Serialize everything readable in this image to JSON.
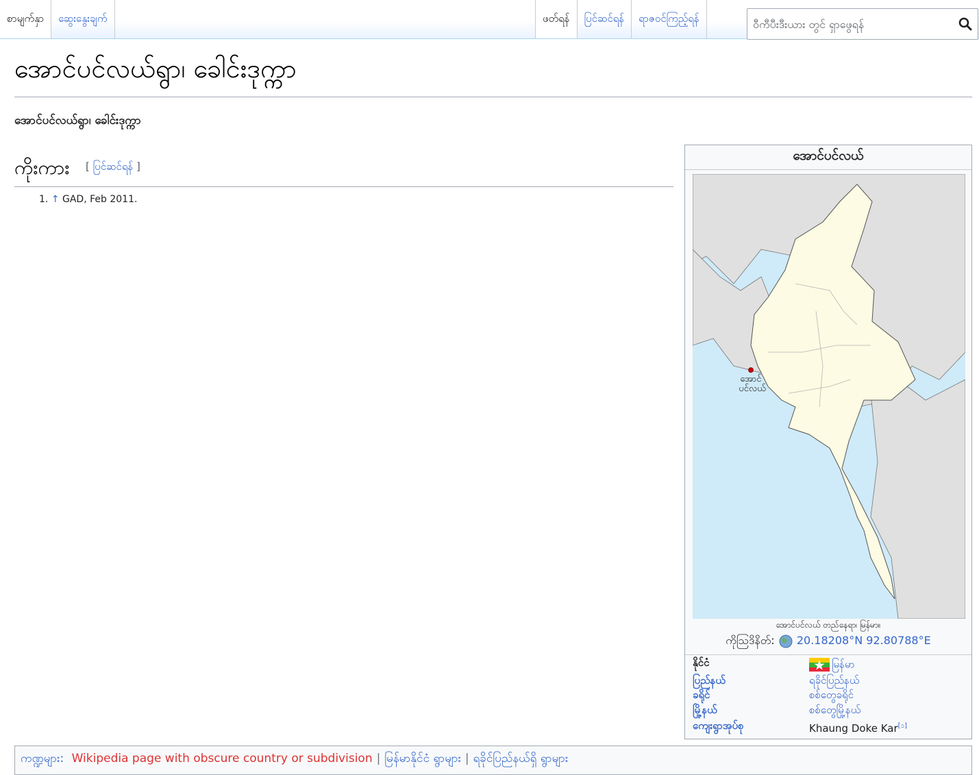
{
  "tabs": {
    "article": "စာမျက်နှာ",
    "talk": "ဆွေးနွေးချက်",
    "read": "ဖတ်ရန်",
    "edit": "ပြင်ဆင်ရန်",
    "history": "ရာဇဝင်ကြည့်ရန်"
  },
  "search": {
    "placeholder": "ဝီကီပီးဒီးယား တွင် ရှာဖွေရန်",
    "icon": "magnifier"
  },
  "page": {
    "title": "အောင်ပင်လယ်ရွာ၊ ခေါင်းဒုက္ကာ",
    "lead": "အောင်ပင်လယ်ရွာ၊ ခေါင်းဒုက္ကာ"
  },
  "section": {
    "heading": "ကိုးကား",
    "edit_open": "[ ",
    "edit_label": "ပြင်ဆင်ရန်",
    "edit_close": " ]"
  },
  "references": [
    {
      "num": "1.",
      "backlink": "↑",
      "text": "GAD, Feb 2011."
    }
  ],
  "infobox": {
    "title": "အောင်ပင်လယ်",
    "map_label_1": "အောင်",
    "map_label_2": "ပင်လယ်",
    "caption": "အောင်ပင်လယ် တည်နေရာ၊ မြန်မာ။",
    "coords_label": "ကိုဩဒိနိတ်:",
    "coords_value": "20.18208°N 92.80788°E",
    "rows": [
      {
        "label": "နိုင်ငံ",
        "value": "မြန်မာ"
      },
      {
        "label": "ပြည်နယ်",
        "value": "ရခိုင်ပြည်နယ်"
      },
      {
        "label": "ခရိုင်",
        "value": "စစ်တွေခရိုင်"
      },
      {
        "label": "မြို့နယ်",
        "value": "စစ်တွေမြို့နယ်"
      },
      {
        "label": "ကျေးရွာအုပ်စု",
        "value": "Khaung Doke Kar",
        "ref": "[၁]"
      }
    ],
    "colors": {
      "land": "#fdfbe3",
      "sea": "#cfeaf8",
      "neighbors": "#e0e0e0",
      "marker": "#cc0000"
    }
  },
  "categories": {
    "label": "ကဏ္ဍများ:",
    "items": [
      "Wikipedia page with obscure country or subdivision",
      "မြန်မာနိုင်ငံ ရွာများ",
      "ရခိုင်ပြည်နယ်ရှိ ရွာများ"
    ]
  }
}
